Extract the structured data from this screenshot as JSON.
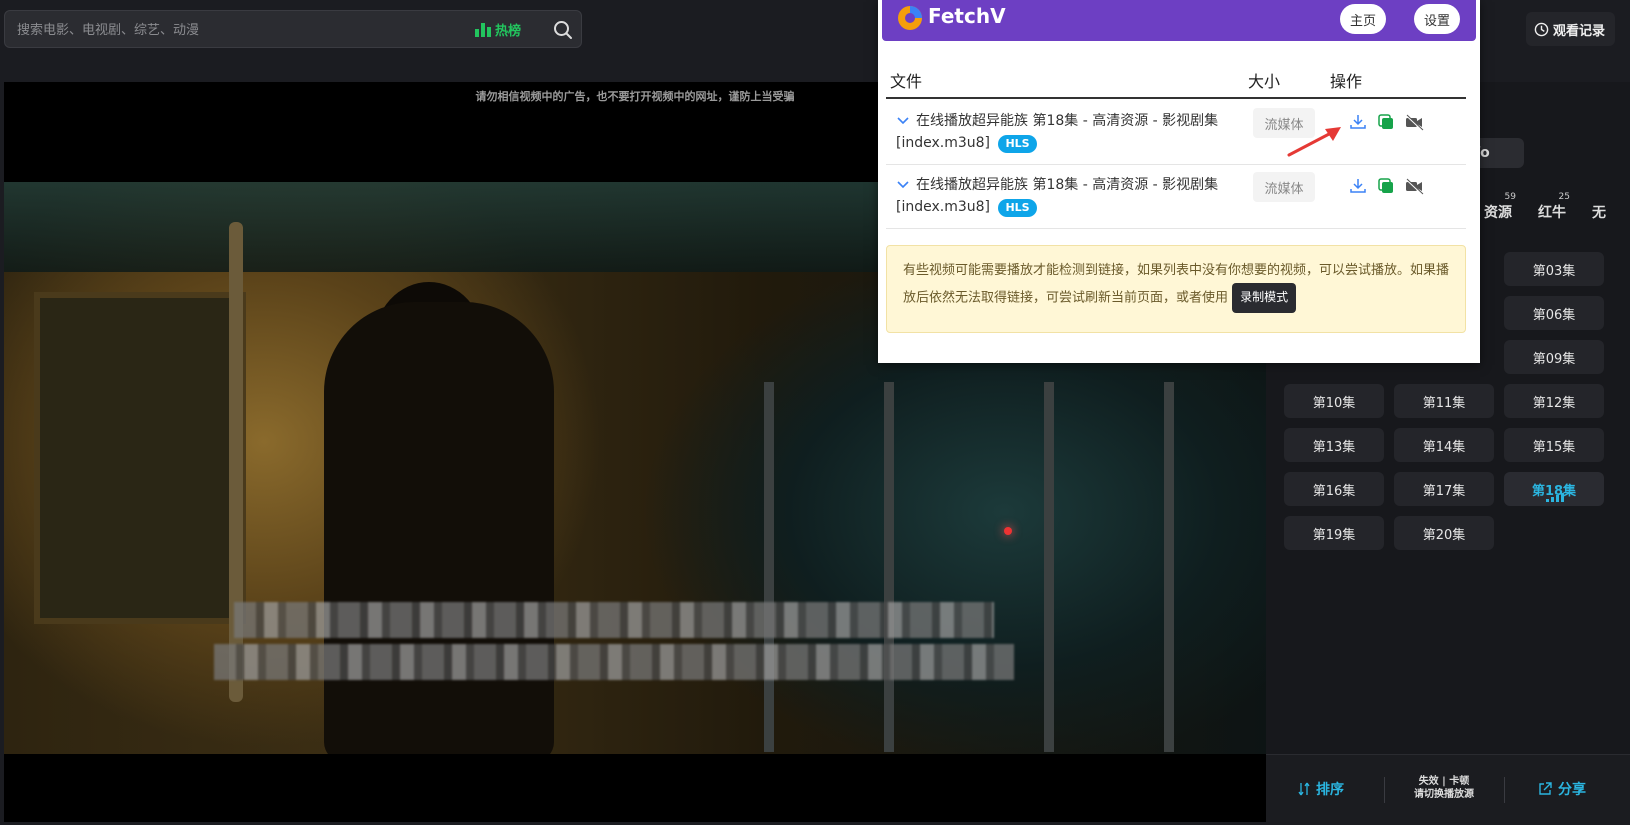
{
  "search": {
    "placeholder": "搜索电影、电视剧、综艺、动漫",
    "hot_label": "热榜"
  },
  "history_label": "观看记录",
  "video": {
    "ad_warning": "请勿相信视频中的广告，也不要打开视频中的网址，谨防上当受骗"
  },
  "right_panel": {
    "partial_chip": "fo",
    "sources": [
      {
        "label": "资源",
        "count": "59"
      },
      {
        "label": "红牛",
        "count": "25"
      },
      {
        "label": "无",
        "count": ""
      }
    ],
    "episodes": [
      "第03集",
      "第06集",
      "第09集",
      "第10集",
      "第11集",
      "第12集",
      "第13集",
      "第14集",
      "第15集",
      "第16集",
      "第17集",
      "第18集",
      "第19集",
      "第20集"
    ],
    "active_episode": "第18集",
    "sort_label": "排序",
    "switch_hint_line1": "失效 | 卡顿",
    "switch_hint_line2": "请切换播放源",
    "share_label": "分享"
  },
  "fetchv": {
    "title": "FetchV",
    "nav_home": "主页",
    "nav_settings": "设置",
    "col_file": "文件",
    "col_size": "大小",
    "col_action": "操作",
    "rows": [
      {
        "name": "在线播放超异能族 第18集 - 高清资源 - 影视剧集[index.m3u8]",
        "tag": "HLS",
        "size": "流媒体"
      },
      {
        "name": "在线播放超异能族 第18集 - 高清资源 - 影视剧集[index.m3u8]",
        "tag": "HLS",
        "size": "流媒体"
      }
    ],
    "note_text": "有些视频可能需要播放才能检测到链接，如果列表中没有你想要的视频，可以尝试播放。如果播放后依然无法取得链接，可尝试刷新当前页面，或者使用",
    "record_mode_label": "录制模式"
  },
  "colors": {
    "accent_purple": "#6d3fc3",
    "hot_green": "#22c55e",
    "active_blue": "#2bb5e0",
    "hls_blue": "#0ea5e9"
  }
}
